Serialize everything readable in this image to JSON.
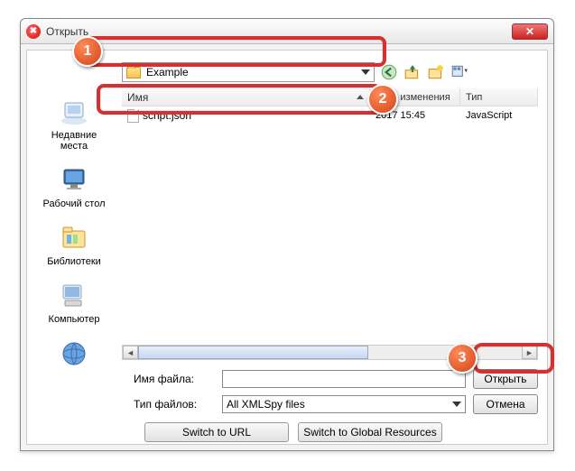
{
  "window": {
    "title": "Открыть"
  },
  "lookin_folder": "Example",
  "columns": {
    "name": "Имя",
    "date": "Дата изменения",
    "type": "Тип"
  },
  "files": [
    {
      "name": "script.json",
      "date": "2017 15:45",
      "type": "JavaScript"
    }
  ],
  "sidebar": {
    "recent": "Недавние\nместа",
    "desktop": "Рабочий стол",
    "libraries": "Библиотеки",
    "computer": "Компьютер",
    "network": ""
  },
  "labels": {
    "filename": "Имя файла:",
    "filetype": "Тип файлов:"
  },
  "filename_value": "",
  "filetype_value": "All XMLSpy files",
  "buttons": {
    "open": "Открыть",
    "cancel": "Отмена",
    "switch_url": "Switch to URL",
    "switch_global": "Switch to Global Resources"
  },
  "markers": {
    "m1": "1",
    "m2": "2",
    "m3": "3"
  }
}
